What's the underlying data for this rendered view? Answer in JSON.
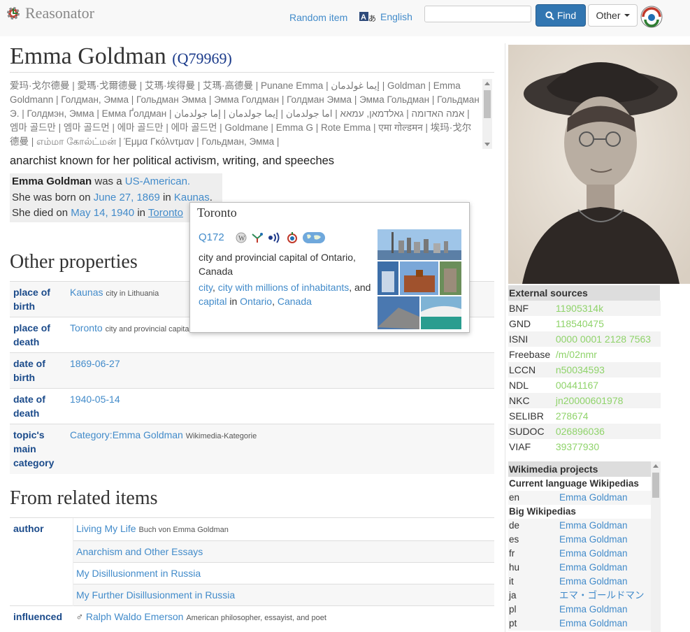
{
  "app": {
    "name": "Reasonator"
  },
  "nav": {
    "random_item": "Random item",
    "language": "English",
    "find_label": "Find",
    "other_label": "Other"
  },
  "search": {
    "value": "",
    "placeholder": ""
  },
  "item": {
    "label": "Emma Goldman",
    "qid": "(Q79969)",
    "aliases": "爱玛·戈尔德曼 | 愛瑪·戈爾德曼 | 艾瑪·埃得曼 | 艾瑪·高德曼 | Punane Emma | إيما غولدمان | Goldman | Emma Goldmann | Голдман, Эмма | Гольдман Эмма | Эмма Голдман | Голдман Эмма | Эмма Гольдман | Гольдман Э. | Голдмэн, Эмма | Емма Ґолдман | אמה האדומה | גאלדמאן, עמאא | اما جولدمان | إيما جولدمان | إما جولدمان | 엠마 골드만 | 엠마 골드먼 | 에마 골드만 | 에마 골드먼 | Goldmane | Emma G | Rote Emma | एमा गोल्डमन | 埃玛·戈尔德曼 | எம்மா கோல்ட்மன் | Έμμα Γκόλντμαν | Гольдман, Эмма |",
    "description": "anarchist known for her political activism, writing, and speeches",
    "summary": {
      "name": "Emma Goldman",
      "was_a": " was a ",
      "nationality": "US-American.",
      "born_prefix": "She was born on ",
      "birth_date": "June 27, 1869",
      "in1": " in ",
      "birth_place": "Kaunas",
      "period1": ".",
      "died_prefix": "She died on ",
      "death_date": "May 14, 1940",
      "in2": " in ",
      "death_place": "Toronto"
    }
  },
  "other_properties": {
    "heading": "Other properties",
    "rows": [
      {
        "key": "place of birth",
        "value": "Kaunas",
        "desc": "city in Lithuania"
      },
      {
        "key": "place of death",
        "value": "Toronto",
        "desc": "city and provincial capital o"
      },
      {
        "key": "date of birth",
        "value": "1869-06-27",
        "desc": ""
      },
      {
        "key": "date of death",
        "value": "1940-05-14",
        "desc": ""
      },
      {
        "key": "topic's main category",
        "value": "Category:Emma Goldman",
        "desc": "Wikimedia-Kategorie"
      }
    ]
  },
  "related": {
    "heading": "From related items",
    "author_key": "author",
    "author_items": [
      {
        "value": "Living My Life",
        "desc": "Buch von Emma Goldman"
      },
      {
        "value": "Anarchism and Other Essays",
        "desc": ""
      },
      {
        "value": "My Disillusionment in Russia",
        "desc": ""
      },
      {
        "value": "My Further Disillusionment in Russia",
        "desc": ""
      }
    ],
    "influenced_key": "influenced",
    "influenced_symbol": "♂",
    "influenced_value": "Ralph Waldo Emerson",
    "influenced_desc": "American philosopher, essayist, and poet"
  },
  "popup": {
    "title": "Toronto",
    "qid": "Q172",
    "description": "city and provincial capital of Ontario, Canada",
    "class1": "city",
    "sep1": ", ",
    "class2": "city with millions of inhabitants",
    "and": ", and ",
    "class3": "capital",
    "in": " in ",
    "loc1": "Ontario",
    "sep2": ", ",
    "loc2": "Canada",
    "icons": [
      "wikipedia-icon",
      "wikidata-icon",
      "audio-icon",
      "commons-icon",
      "map-icon"
    ]
  },
  "external_sources": {
    "heading": "External sources",
    "rows": [
      {
        "key": "BNF",
        "value": "11905314k"
      },
      {
        "key": "GND",
        "value": "118540475"
      },
      {
        "key": "ISNI",
        "value": "0000 0001 2128 7563"
      },
      {
        "key": "Freebase",
        "value": "/m/02nmr"
      },
      {
        "key": "LCCN",
        "value": "n50034593"
      },
      {
        "key": "NDL",
        "value": "00441167"
      },
      {
        "key": "NKC",
        "value": "jn20000601978"
      },
      {
        "key": "SELIBR",
        "value": "278674"
      },
      {
        "key": "SUDOC",
        "value": "026896036"
      },
      {
        "key": "VIAF",
        "value": "39377930"
      }
    ]
  },
  "wikimedia": {
    "heading": "Wikimedia projects",
    "current_heading": "Current language Wikipedias",
    "current": [
      {
        "code": "en",
        "title": "Emma Goldman"
      }
    ],
    "big_heading": "Big Wikipedias",
    "big": [
      {
        "code": "de",
        "title": "Emma Goldman"
      },
      {
        "code": "es",
        "title": "Emma Goldman"
      },
      {
        "code": "fr",
        "title": "Emma Goldman"
      },
      {
        "code": "hu",
        "title": "Emma Goldman"
      },
      {
        "code": "it",
        "title": "Emma Goldman"
      },
      {
        "code": "ja",
        "title": "エマ・ゴールドマン"
      },
      {
        "code": "pl",
        "title": "Emma Goldman"
      },
      {
        "code": "pt",
        "title": "Emma Goldman"
      }
    ]
  },
  "colors": {
    "link": "#428bca",
    "find_button": "#3276b1",
    "external_value": "#8fd36a",
    "key_text": "#1a4a8a"
  }
}
